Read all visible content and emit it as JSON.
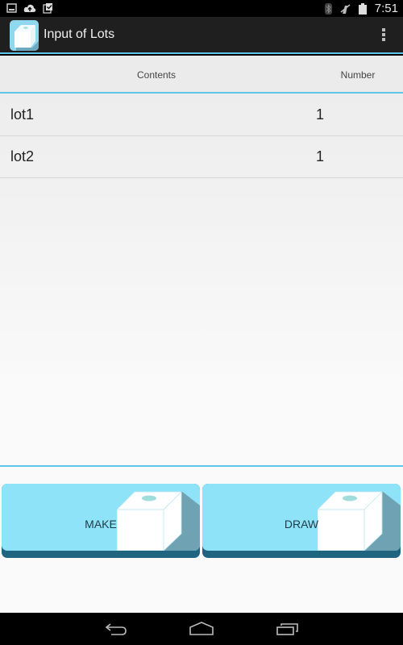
{
  "status_bar": {
    "left_icons": [
      "image-notification-icon",
      "cloud-upload-icon",
      "clipboard-check-icon"
    ],
    "right_icons": [
      "bluetooth-icon",
      "signal-off-icon",
      "battery-icon"
    ],
    "time": "7:51"
  },
  "action_bar": {
    "app_icon": "box-app-icon",
    "title": "Input of Lots",
    "overflow_icon": "overflow-menu-icon"
  },
  "table": {
    "columns": [
      "Contents",
      "Number"
    ],
    "rows": [
      {
        "contents": "lot1",
        "number": "1"
      },
      {
        "contents": "lot2",
        "number": "1"
      }
    ]
  },
  "buttons": {
    "make_label": "MAKE",
    "draw_label": "DRAW"
  },
  "navigation": {
    "back": "back-icon",
    "home": "home-icon",
    "recents": "recent-apps-icon"
  },
  "colors": {
    "accent": "#5ec5e8",
    "button_face": "#8fe3f8",
    "button_shadow": "#1f6580"
  }
}
